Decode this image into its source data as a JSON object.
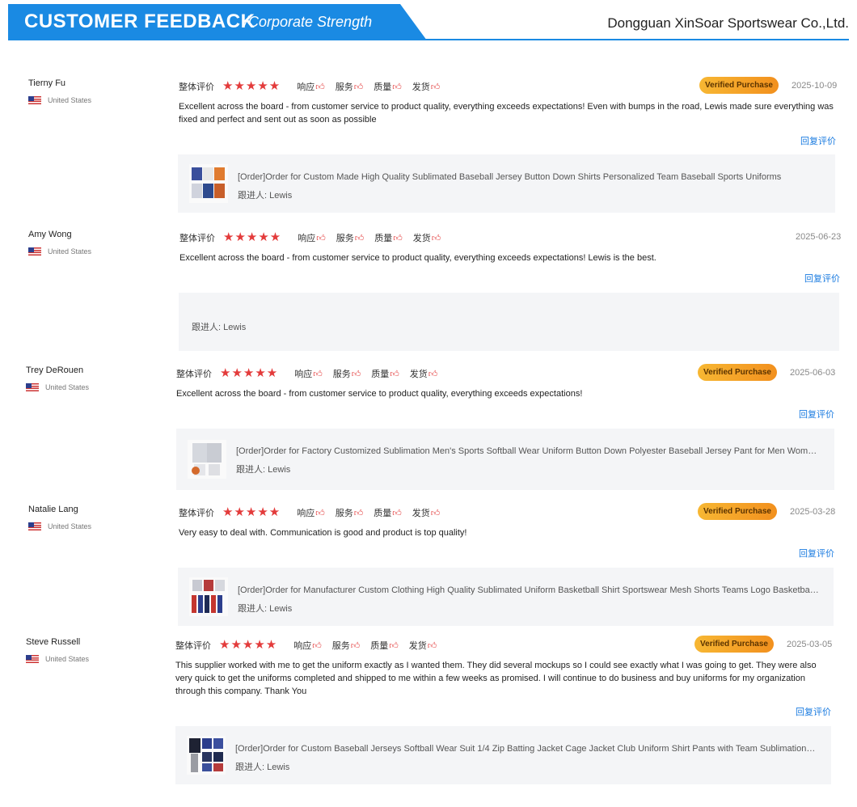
{
  "header": {
    "title": "CUSTOMER FEEDBACK",
    "subtitle": "/Corporate Strength",
    "company": "Dongguan XinSoar Sportswear Co.,Ltd.",
    "accent_color": "#1a8ae3"
  },
  "labels": {
    "overall": "整体评价",
    "response": "响应",
    "service": "服务",
    "quality": "质量",
    "shipping": "发货",
    "reply": "回复评价",
    "verified": "Verified Purchase",
    "star_icon": "star-icon",
    "thumb_icon": "thumbs-up-icon"
  },
  "reviews": [
    {
      "name": "Tierny Fu",
      "country": "United States",
      "stars": 5,
      "verified": true,
      "date": "2025-10-09",
      "text": "Excellent across the board - from customer service to product quality, everything exceeds expectations! Even with bumps in the road, Lewis made sure everything was fixed and perfect and sent out as soon as possible",
      "order_title": "[Order]Order for Custom Made High Quality Sublimated Baseball Jersey Button Down Shirts Personalized Team Baseball Sports Uniforms",
      "follow_up": "跟进人: Lewis"
    },
    {
      "name": "Amy Wong",
      "country": "United States",
      "stars": 5,
      "verified": false,
      "date": "2025-06-23",
      "text": "Excellent across the board - from customer service to product quality, everything exceeds expectations! Lewis is the best.",
      "order_title": "",
      "follow_up": "跟进人: Lewis"
    },
    {
      "name": "Trey DeRouen",
      "country": "United States",
      "stars": 5,
      "verified": true,
      "date": "2025-06-03",
      "text": "Excellent across the board - from customer service to product quality, everything exceeds expectations!",
      "order_title": "[Order]Order for Factory Customized Sublimation Men's Sports Softball Wear Uniform Button Down Polyester Baseball Jersey Pant for Men Women Kids",
      "follow_up": "跟进人: Lewis"
    },
    {
      "name": "Natalie Lang",
      "country": "United States",
      "stars": 5,
      "verified": true,
      "date": "2025-03-28",
      "text": "Very easy to deal with. Communication is good and product is top quality!",
      "order_title": "[Order]Order for Manufacturer Custom Clothing High Quality Sublimated Uniform Basketball Shirt Sportswear Mesh Shorts Teams Logo Basketball Jersey",
      "follow_up": "跟进人: Lewis"
    },
    {
      "name": "Steve Russell",
      "country": "United States",
      "stars": 5,
      "verified": true,
      "date": "2025-03-05",
      "text": "This supplier worked with me to get the uniform exactly as I wanted them. They did several mockups so I could see exactly what I was going to get. They were also very quick to get the uniforms completed and shipped to me within a few weeks as promised. I will continue to do business and buy uniforms for my organization through this company. Thank You",
      "order_title": "[Order]Order for Custom Baseball Jerseys Softball Wear Suit 1/4 Zip Batting Jacket Cage Jacket Club Uniform Shirt Pants with Team Sublimation Embroidery",
      "follow_up": "跟进人: Lewis"
    }
  ]
}
